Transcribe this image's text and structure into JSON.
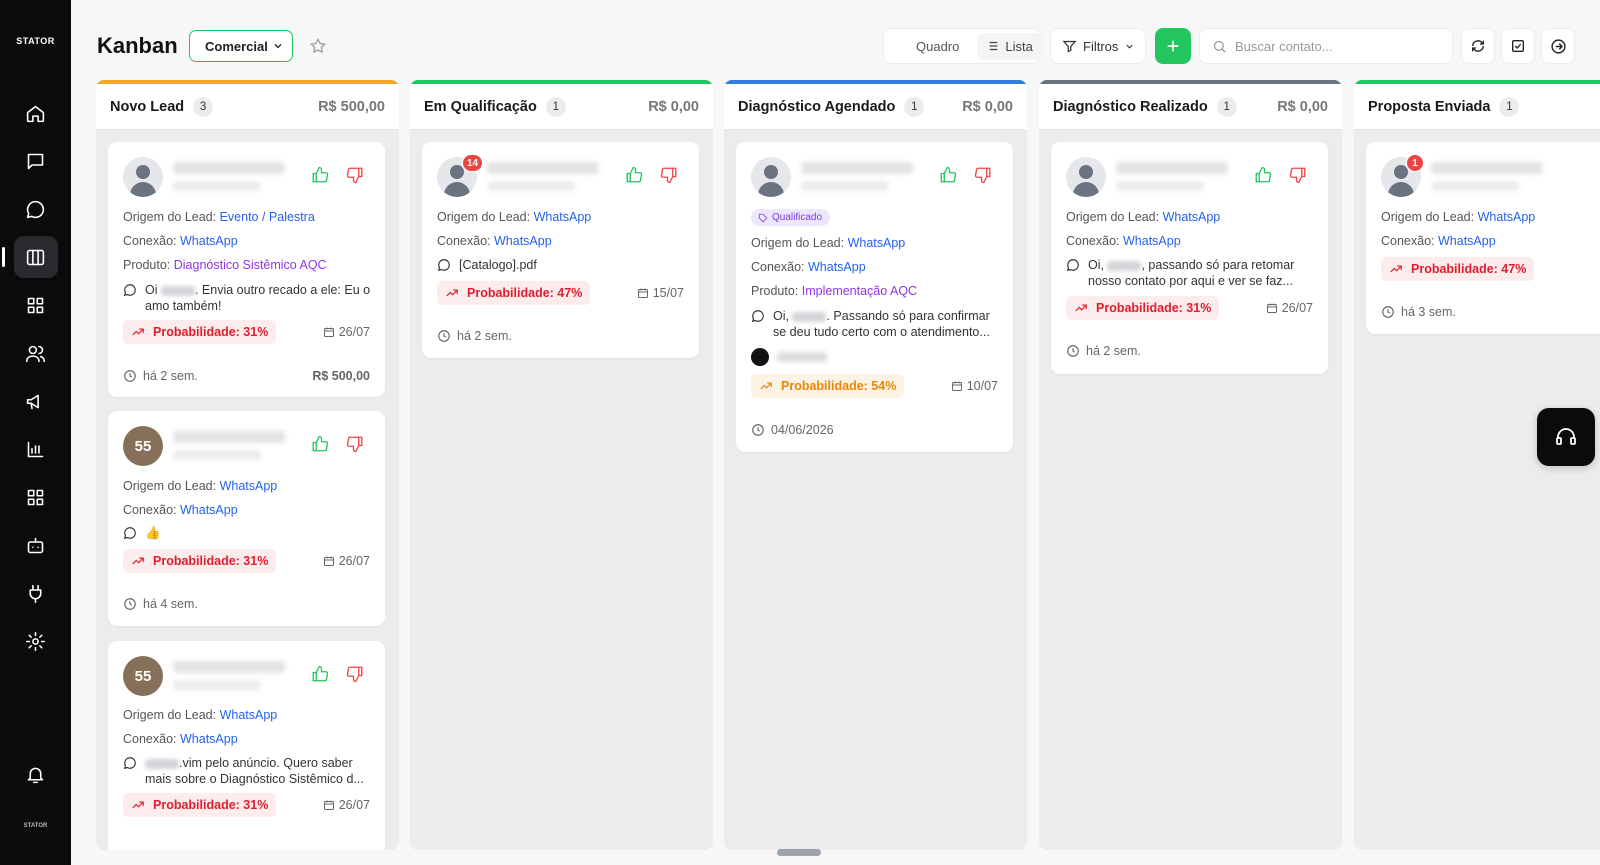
{
  "sidebar": {
    "brand": "STATOR",
    "brand_small": "STATOR",
    "items": [
      {
        "icon": "home-icon"
      },
      {
        "icon": "chat-square-icon"
      },
      {
        "icon": "chat-bubble-icon"
      },
      {
        "icon": "kanban-icon",
        "active": true
      },
      {
        "icon": "grid-icon"
      },
      {
        "icon": "users-icon"
      },
      {
        "icon": "megaphone-icon"
      },
      {
        "icon": "bar-chart-icon"
      },
      {
        "icon": "apps-icon"
      },
      {
        "icon": "bot-icon"
      },
      {
        "icon": "plug-icon"
      },
      {
        "icon": "gear-icon"
      }
    ],
    "bottom_icon": "bell-icon"
  },
  "header": {
    "title": "Kanban",
    "pipeline": "Comercial",
    "view_board": "Quadro",
    "view_list": "Lista",
    "filters": "Filtros",
    "search_placeholder": "Buscar contato..."
  },
  "labels": {
    "origin": "Origem do Lead:",
    "connection": "Conexão:",
    "product": "Produto:",
    "probability_prefix": "Probabilidade:"
  },
  "columns": [
    {
      "name": "Novo Lead",
      "count": "3",
      "total": "R$ 500,00",
      "accent": "#f5a623",
      "cards": [
        {
          "origin": "Evento / Palestra",
          "connection": "WhatsApp",
          "product": "Diagnóstico Sistêmico AQC",
          "msg_pre": "Oi",
          "msg_post": ". Envia outro recado a ele: Eu o amo também!",
          "probability": "Probabilidade: 31%",
          "due": "26/07",
          "age": "há 2 sem.",
          "value": "R$ 500,00"
        },
        {
          "avatar": "55",
          "origin": "WhatsApp",
          "connection": "WhatsApp",
          "msg": "👍",
          "probability": "Probabilidade: 31%",
          "due": "26/07",
          "age": "há 4 sem."
        },
        {
          "avatar": "55",
          "origin": "WhatsApp",
          "connection": "WhatsApp",
          "msg_post": ".vim pelo anúncio. Quero saber mais sobre o Diagnóstico Sistêmico d...",
          "probability": "Probabilidade: 31%",
          "due": "26/07"
        }
      ]
    },
    {
      "name": "Em Qualificação",
      "count": "1",
      "total": "R$ 0,00",
      "accent": "#22c55e",
      "cards": [
        {
          "badge": "14",
          "origin": "WhatsApp",
          "connection": "WhatsApp",
          "msg": "[Catalogo].pdf",
          "probability": "Probabilidade: 47%",
          "due": "15/07",
          "age": "há 2 sem."
        }
      ]
    },
    {
      "name": "Diagnóstico Agendado",
      "count": "1",
      "total": "R$ 0,00",
      "accent": "#2f7de1",
      "cards": [
        {
          "tag": "Qualificado",
          "origin": "WhatsApp",
          "connection": "WhatsApp",
          "product": "Implementação AQC",
          "msg_pre": "Oi,",
          "msg_post": ". Passando só para confirmar se deu tudo certo com o atendimento...",
          "probability": "Probabilidade: 54%",
          "due": "10/07",
          "age": "04/06/2026"
        }
      ]
    },
    {
      "name": "Diagnóstico Realizado",
      "count": "1",
      "total": "R$ 0,00",
      "accent": "#6b7280",
      "cards": [
        {
          "origin": "WhatsApp",
          "connection": "WhatsApp",
          "msg_pre": "Oi,",
          "msg_post": ", passando só para retomar nosso contato por aqui e ver se faz...",
          "probability": "Probabilidade: 31%",
          "due": "26/07",
          "age": "há 2 sem."
        }
      ]
    },
    {
      "name": "Proposta Enviada",
      "count": "1",
      "accent": "#22c55e",
      "cards": [
        {
          "badge": "1",
          "origin": "WhatsApp",
          "connection": "WhatsApp",
          "probability": "Probabilidade: 47%",
          "age": "há 3 sem."
        }
      ]
    }
  ]
}
